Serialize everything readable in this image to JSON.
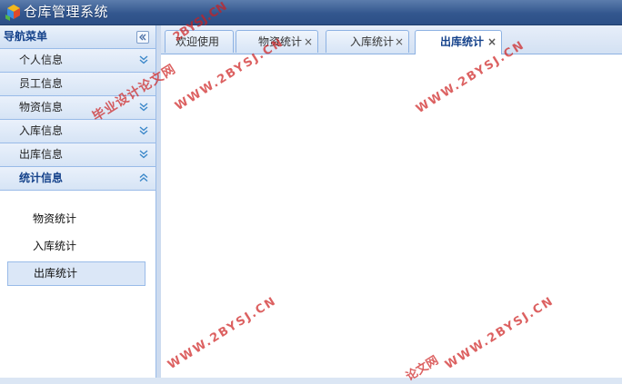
{
  "app": {
    "title": "仓库管理系统",
    "logo_icon": "cubes-logo-icon"
  },
  "nav": {
    "header": "导航菜单",
    "collapse_icon": "double-chevron-left-icon",
    "items": [
      {
        "label": "个人信息",
        "icon": "double-chevron-down-icon"
      },
      {
        "label": "员工信息",
        "icon": ""
      },
      {
        "label": "物资信息",
        "icon": "double-chevron-down-icon"
      },
      {
        "label": "入库信息",
        "icon": "double-chevron-down-icon"
      },
      {
        "label": "出库信息",
        "icon": "double-chevron-down-icon"
      },
      {
        "label": "统计信息",
        "icon": "double-chevron-up-icon",
        "expanded": true
      }
    ],
    "sub_items": [
      {
        "label": "物资统计"
      },
      {
        "label": "入库统计"
      },
      {
        "label": "出库统计",
        "selected": true
      }
    ]
  },
  "tabs": [
    {
      "label": "欢迎使用",
      "closable": false
    },
    {
      "label": "物资统计",
      "closable": true,
      "close_label": "×"
    },
    {
      "label": "入库统计",
      "closable": true,
      "close_label": "×"
    },
    {
      "label": "出库统计",
      "closable": true,
      "close_label": "×",
      "active": true
    }
  ],
  "watermark": {
    "site": "WWW.2BYSJ.CN",
    "site_short": "2BYSJ.CN",
    "cn_text": "毕业设计论文网",
    "cn_short": "论文网",
    "color": "#cd1e1e"
  },
  "colors": {
    "titlebar": "#33578e",
    "panel_border": "#99bbe8",
    "header_text": "#15428b"
  }
}
